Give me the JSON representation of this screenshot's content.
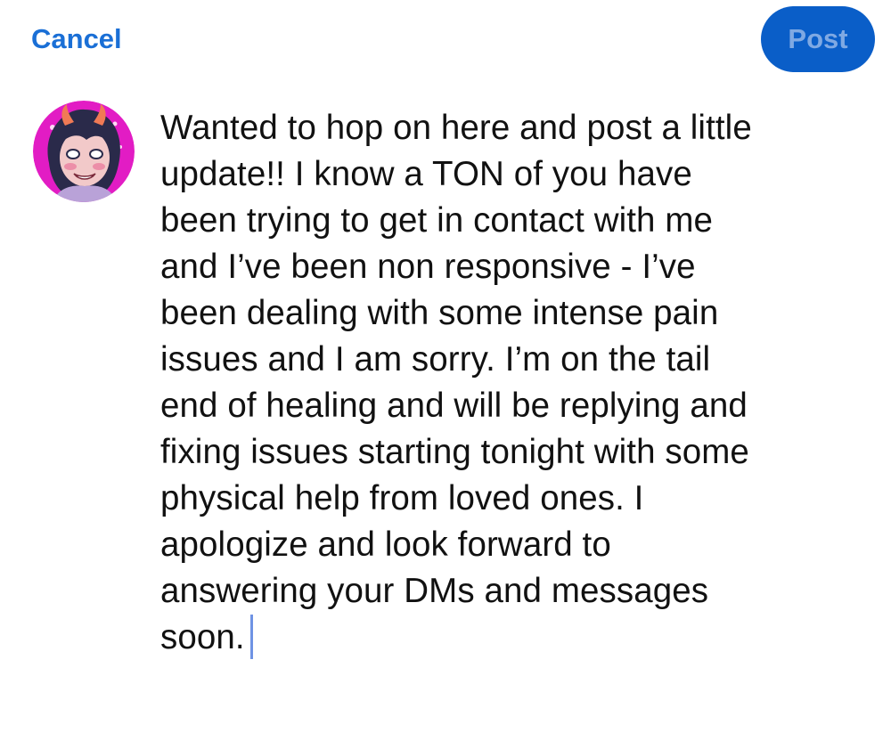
{
  "header": {
    "cancel_label": "Cancel",
    "post_label": "Post"
  },
  "composer": {
    "lines": [
      "Wanted to hop on here and post a little",
      "update!! I know a TON of you have",
      "been trying to get in contact with me",
      "and I’ve been non responsive - I’ve",
      "been dealing with some intense pain",
      "issues and I am sorry. I’m on the tail",
      "end of healing and will be replying and",
      "fixing issues starting tonight with some",
      "physical help from loved ones. I",
      "apologize and look forward to",
      "answering your DMs and messages",
      "soon."
    ]
  },
  "colors": {
    "accent": "#1a6fd6",
    "post_button_bg": "#0a5ec8",
    "post_button_text": "#7fa9e3",
    "caret": "#6f93e4",
    "text": "#111111"
  },
  "icons": {
    "avatar": "user-avatar-illustration"
  }
}
